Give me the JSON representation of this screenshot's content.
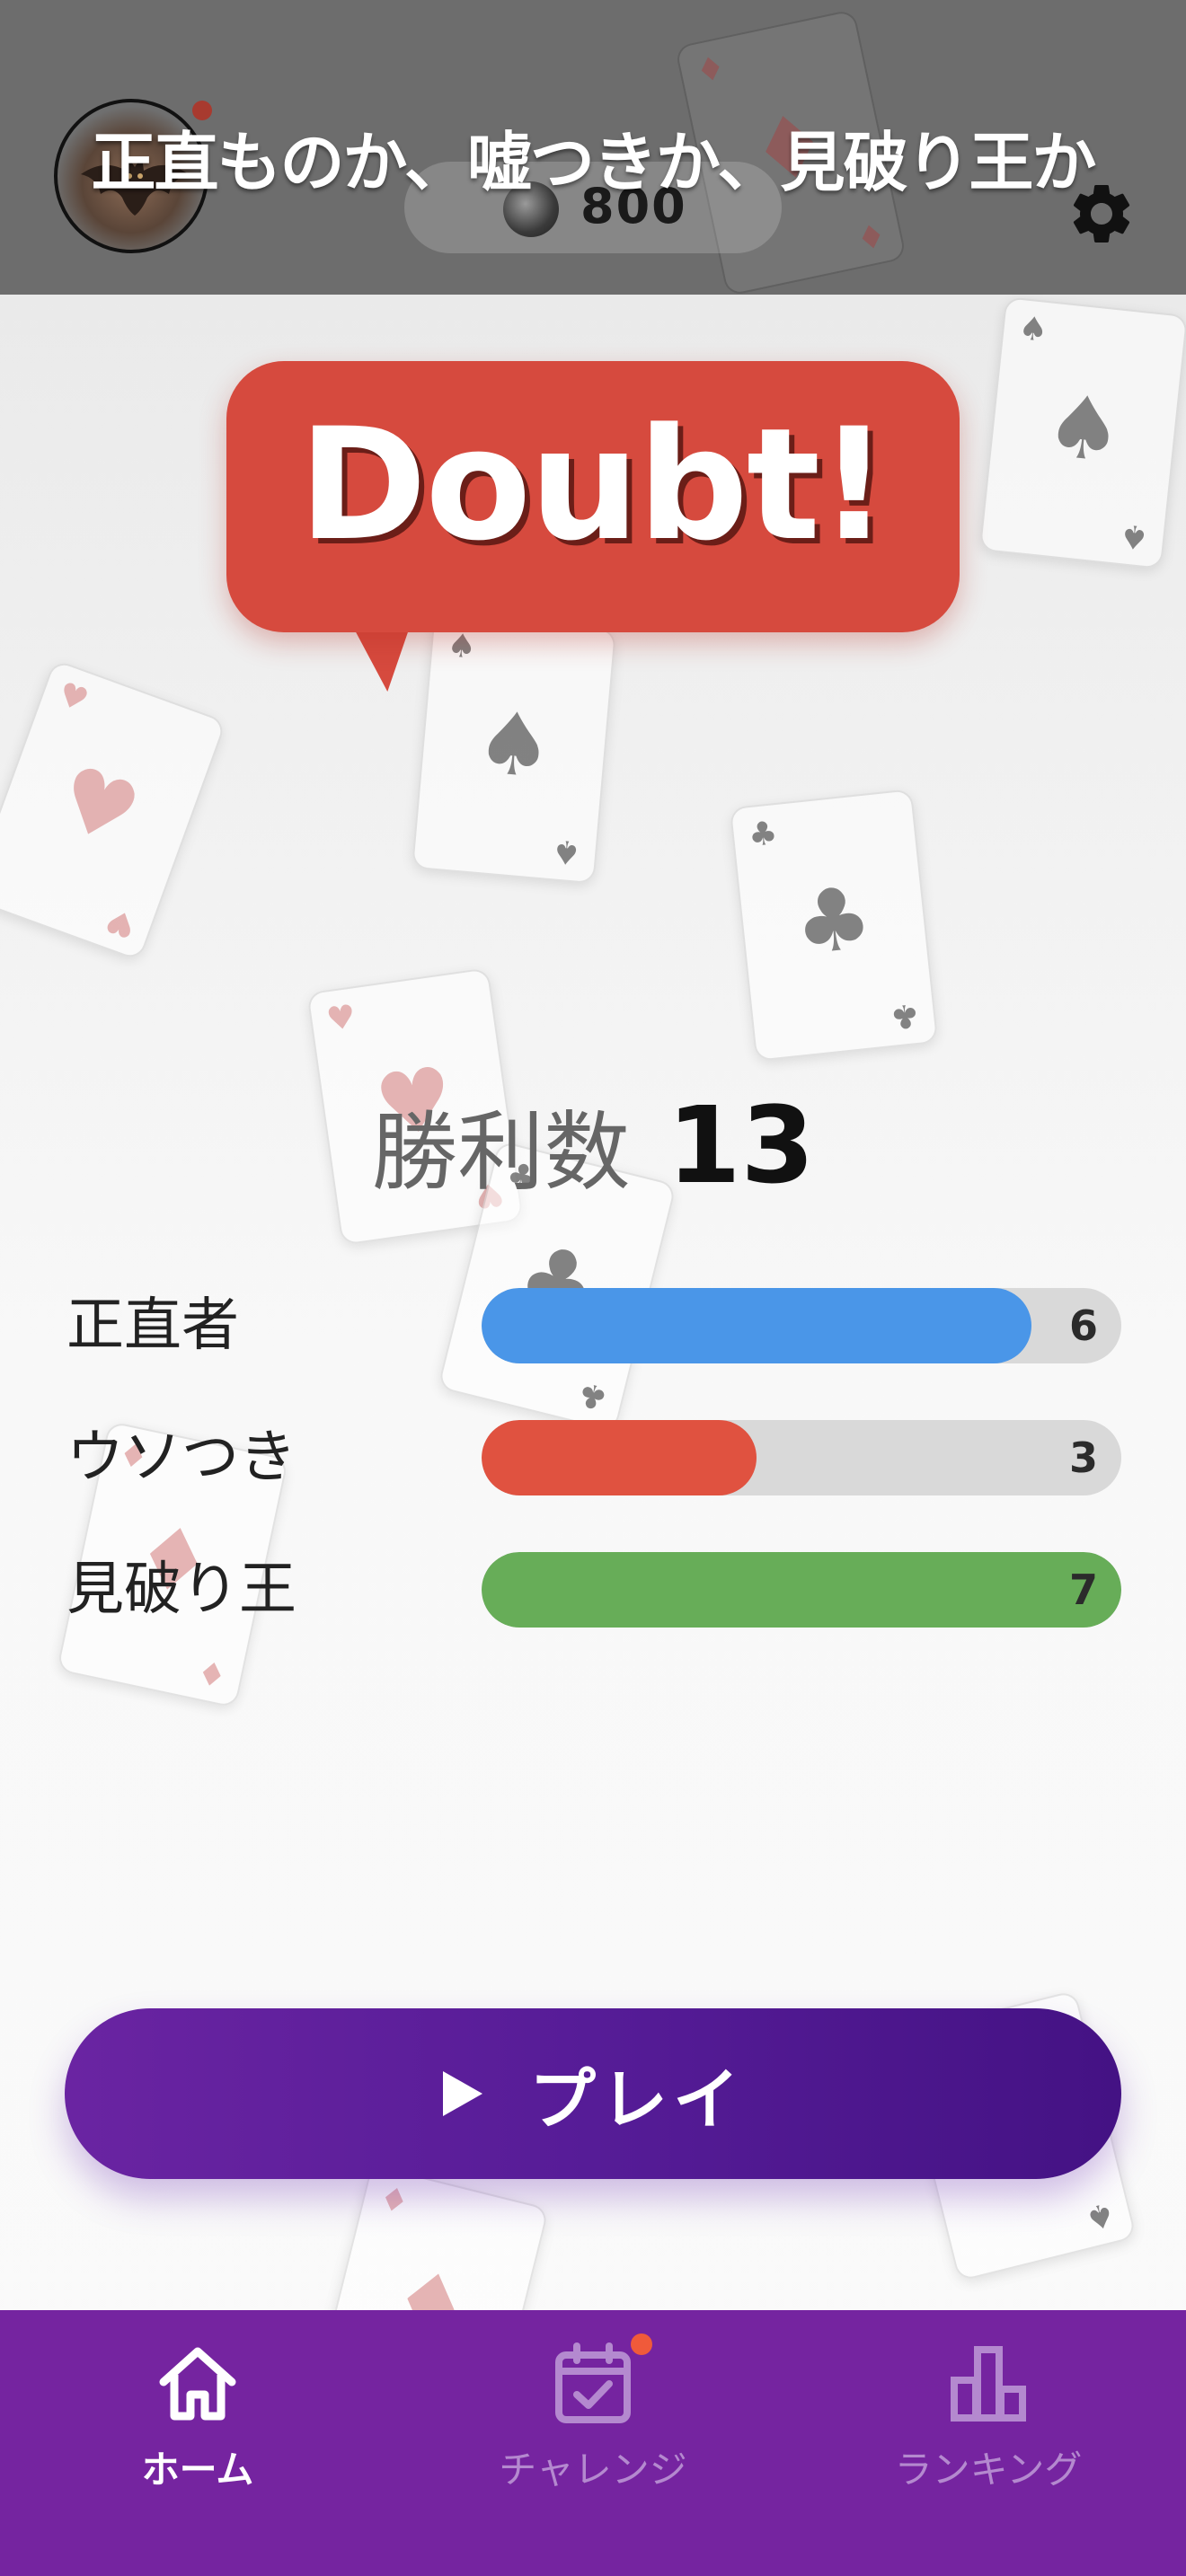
{
  "header": {
    "title": "正直ものか、嘘つきか、見破り王か",
    "coins": "800",
    "coin_icon": "coin-icon",
    "settings_icon": "gear-icon",
    "avatar_icon": "bat-avatar"
  },
  "hero": {
    "doubt_text": "Doubt!"
  },
  "wins": {
    "label": "勝利数",
    "value": "13"
  },
  "stats": [
    {
      "label": "正直者",
      "count": "6",
      "fill_fraction": 0.86,
      "color": "#4a96e8"
    },
    {
      "label": "ウソつき",
      "count": "3",
      "fill_fraction": 0.43,
      "color": "#e05240"
    },
    {
      "label": "見破り王",
      "count": "7",
      "fill_fraction": 1.0,
      "color": "#67ad58"
    }
  ],
  "play_button": {
    "label": "プレイ",
    "icon": "play-icon"
  },
  "nav": {
    "items": [
      {
        "label": "ホーム",
        "icon": "home-icon",
        "active": true
      },
      {
        "label": "チャレンジ",
        "icon": "calendar-check-icon",
        "active": false,
        "badge": true
      },
      {
        "label": "ランキング",
        "icon": "bar-chart-icon",
        "active": false
      }
    ]
  },
  "colors": {
    "header_bg": "#6d6d6d",
    "doubt_red": "#d64a3e",
    "play_purple": "#561c97",
    "nav_purple": "#7524a0",
    "badge": "#f05a3a"
  }
}
